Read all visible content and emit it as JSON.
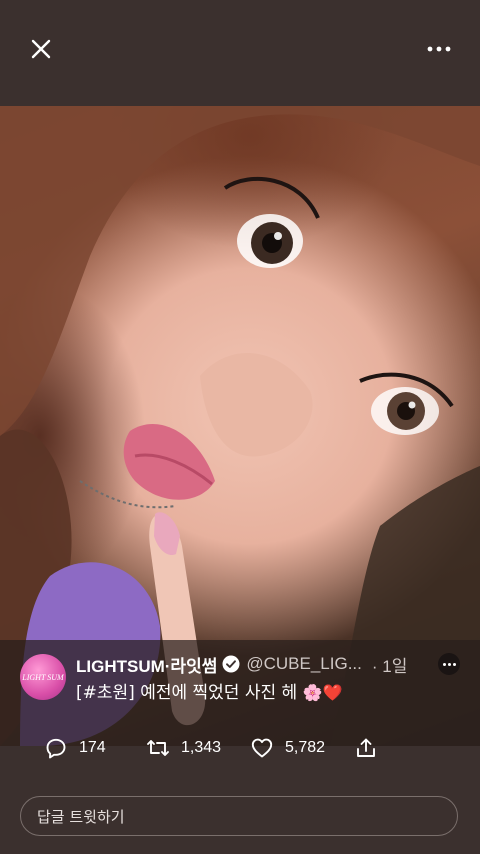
{
  "header": {
    "close_icon": "close-icon",
    "more_icon": "more-horizontal-icon"
  },
  "tweet": {
    "avatar_text": "LIGHT SUM",
    "author_name": "LIGHTSUM·라잇썸",
    "verified_icon": "verified-badge-icon",
    "handle": "@CUBE_LIG...",
    "time": "· 1일",
    "text": "[#초원] 예전에 찍었던 사진 헤",
    "emojis": "🌸❤️"
  },
  "actions": {
    "replies": "174",
    "retweets": "1,343",
    "likes": "5,782"
  },
  "reply": {
    "placeholder": "답글 트윗하기"
  },
  "colors": {
    "background": "#3b302e",
    "avatar": "#d94fa8"
  }
}
